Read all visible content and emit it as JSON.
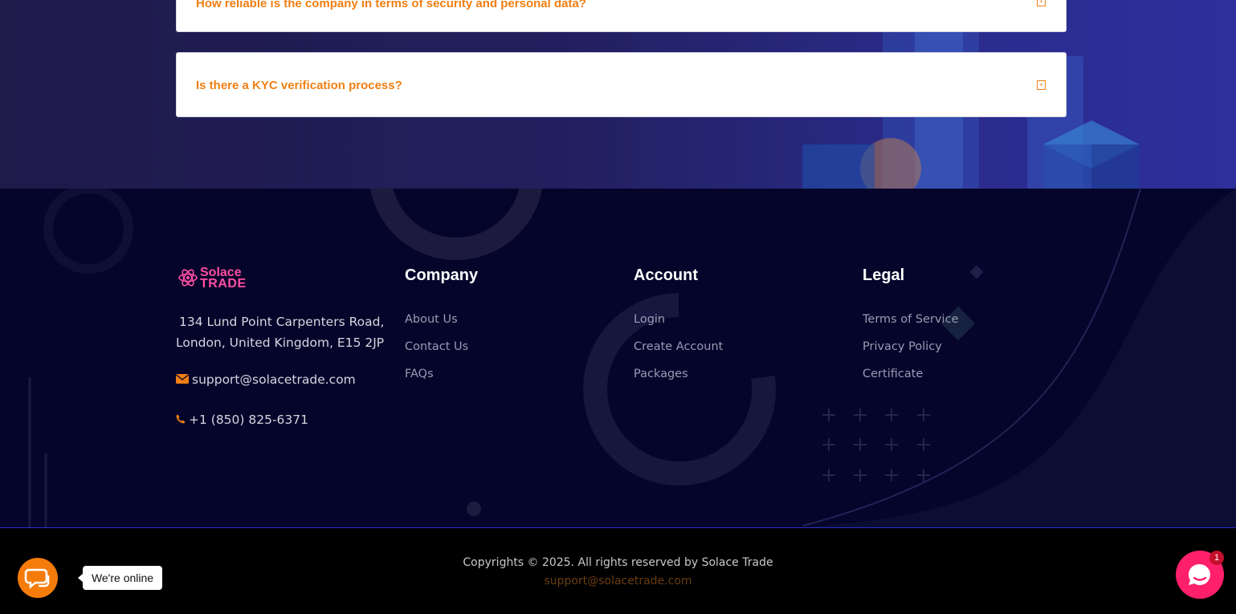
{
  "faq": {
    "items": [
      {
        "question": "How reliable is the company in terms of security and personal data?"
      },
      {
        "question": "Is there a KYC verification process?"
      }
    ]
  },
  "brand": {
    "name_line1": "Solace",
    "name_line2": "TRADE",
    "accent_color": "#ff4fa3"
  },
  "contact": {
    "address_line1": "134 Lund Point Carpenters Road,",
    "address_line2": "London, United Kingdom, E15 2JP",
    "email": "support@solacetrade.com",
    "phone": "+1 (850) 825-6371"
  },
  "columns": [
    {
      "title": "Company",
      "links": [
        "About Us",
        "Contact Us",
        "FAQs"
      ]
    },
    {
      "title": "Account",
      "links": [
        "Login",
        "Create Account",
        "Packages"
      ]
    },
    {
      "title": "Legal",
      "links": [
        "Terms of Service",
        "Privacy Policy",
        "Certificate"
      ]
    }
  ],
  "bottom": {
    "copyright": "Copyrights © 2025. All rights reserved by Solace Trade",
    "email": "support@solacetrade.com"
  },
  "chat": {
    "online_label": "We're online",
    "badge_count": "1",
    "left_color": "#f57c0a",
    "right_color": "#ff1f6b"
  }
}
